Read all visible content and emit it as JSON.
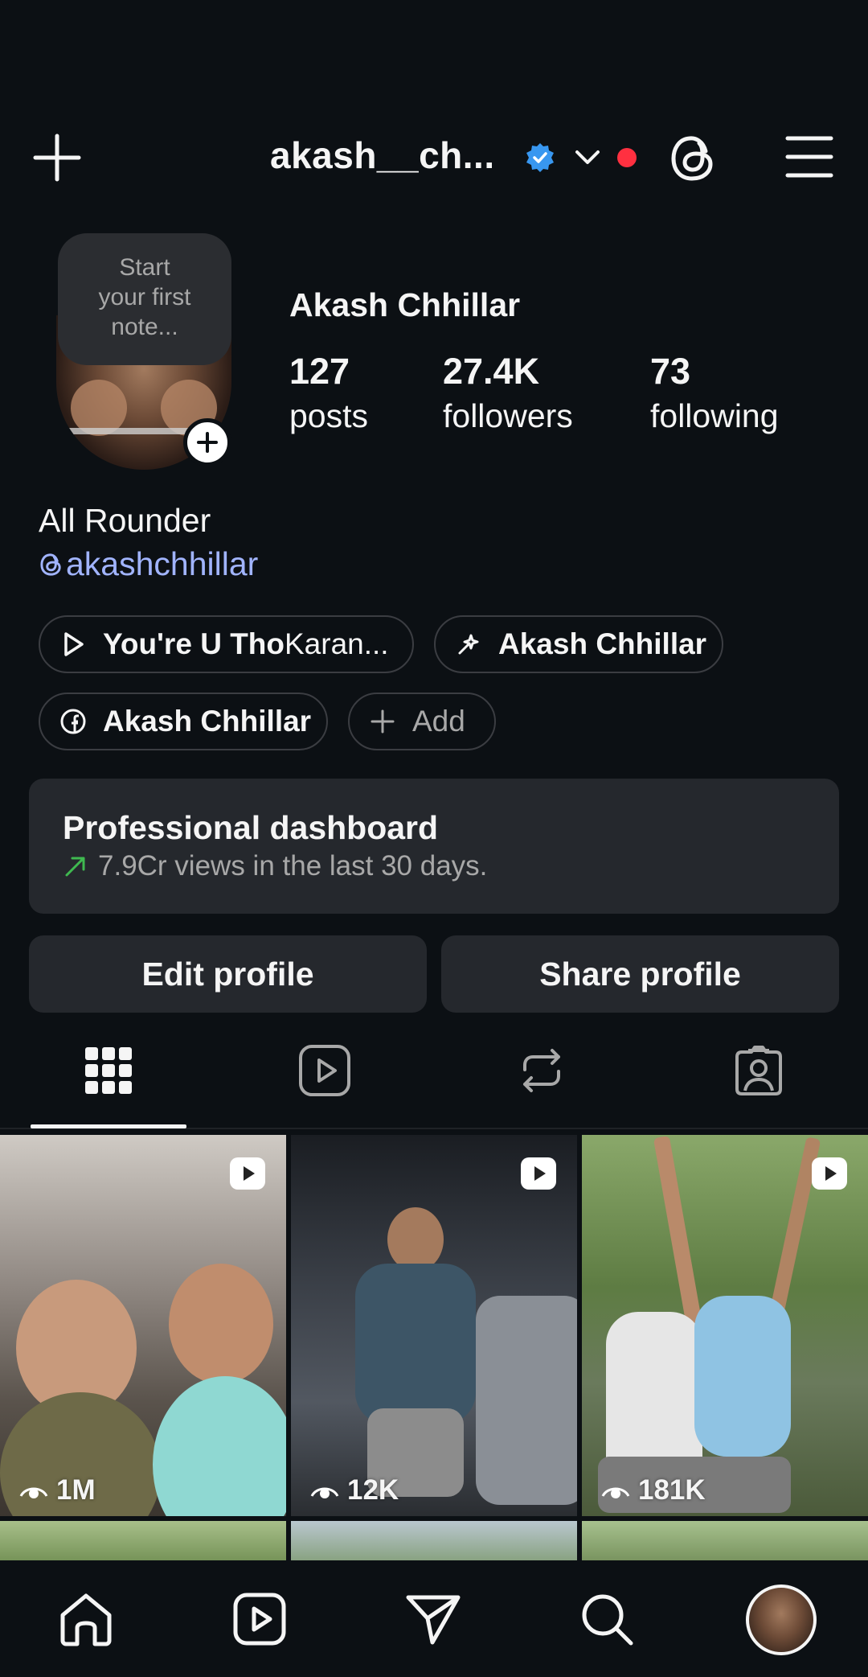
{
  "header": {
    "username": "akash__ch...",
    "add_icon": "plus-icon",
    "verified_icon": "verified-badge-icon",
    "switch_icon": "chevron-down-icon",
    "threads_icon": "threads-icon",
    "menu_icon": "hamburger-menu-icon"
  },
  "note": {
    "line1": "Start",
    "line2": "your first",
    "line3": "note..."
  },
  "profile": {
    "name": "Akash Chhillar",
    "stats": [
      {
        "count": "127",
        "label": "posts"
      },
      {
        "count": "27.4K",
        "label": "followers"
      },
      {
        "count": "73",
        "label": "following"
      }
    ],
    "bio": "All Rounder",
    "threads_handle": "akashchhillar"
  },
  "chips": [
    {
      "icon": "play-icon",
      "label_bold": "You're U Tho",
      "label_rest": " Karan..."
    },
    {
      "icon": "sparkle-icon",
      "label_bold": "Akash Chhillar"
    },
    {
      "icon": "facebook-icon",
      "label_bold": "Akash Chhillar"
    },
    {
      "icon": "plus-icon",
      "label_rest": "Add"
    }
  ],
  "dashboard": {
    "title": "Professional dashboard",
    "subtitle": "7.9Cr views in the last 30 days.",
    "trend_color": "#3fb950"
  },
  "buttons": {
    "edit": "Edit profile",
    "share": "Share profile"
  },
  "tabs": [
    {
      "icon": "grid-icon",
      "active": true
    },
    {
      "icon": "reels-icon",
      "active": false
    },
    {
      "icon": "reposts-icon",
      "active": false
    },
    {
      "icon": "tagged-icon",
      "active": false
    }
  ],
  "posts": [
    {
      "views": "1M"
    },
    {
      "views": "12K"
    },
    {
      "views": "181K"
    }
  ],
  "bottom_nav": [
    "home-icon",
    "reels-icon",
    "direct-message-icon",
    "search-icon",
    "profile-avatar"
  ],
  "colors": {
    "background": "#0c1014",
    "surface": "#25282d",
    "link": "#a1b4ff",
    "verified": "#3897f0",
    "notification_dot": "#ff3040"
  }
}
